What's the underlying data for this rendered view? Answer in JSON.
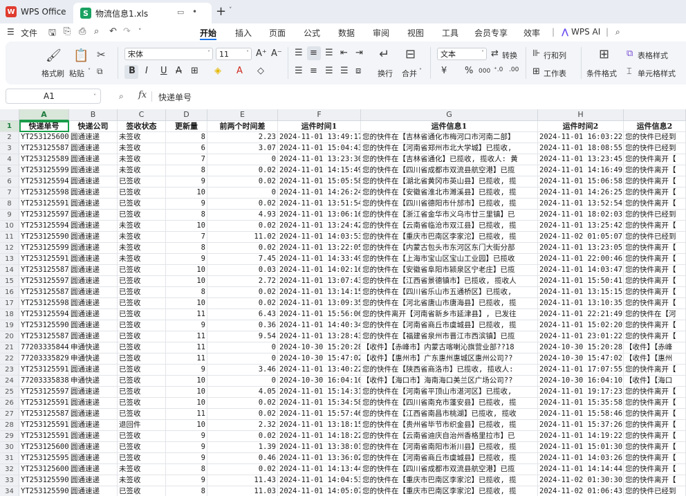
{
  "titlebar": {
    "app_tab": "WPS Office",
    "app_logo": "W",
    "file_tab": "物流信息1.xls",
    "file_logo": "S",
    "new_tab": "+",
    "tab_menu": "˅",
    "window_icon": "▭",
    "modified_dot": "•"
  },
  "menubar": {
    "file_menu": "文件",
    "tabs": [
      "开始",
      "插入",
      "页面",
      "公式",
      "数据",
      "审阅",
      "视图",
      "工具",
      "会员专享",
      "效率",
      "WPS AI"
    ],
    "active_tab": "开始"
  },
  "ribbon": {
    "format_painter": "格式刷",
    "paste": "粘贴",
    "font_name": "宋体",
    "font_size": "11",
    "grow_font": "A⁺",
    "shrink_font": "A⁻",
    "bold": "B",
    "italic": "I",
    "underline": "U",
    "strike": "A",
    "wrap": "换行",
    "merge": "合并",
    "number_format": "文本",
    "convert": "转换",
    "currency": "¥",
    "percent": "%",
    "thousands": "000",
    "rows_cols": "行和列",
    "worksheet": "工作表",
    "cond_format": "条件格式",
    "table_style": "表格样式",
    "cell_style": "单元格样式"
  },
  "formula": {
    "cell_ref": "A1",
    "fx_label": "fx",
    "value": "快递单号"
  },
  "grid": {
    "columns": [
      "A",
      "B",
      "C",
      "D",
      "E",
      "F",
      "G",
      "H"
    ],
    "headers": [
      "快递单号",
      "快递公司",
      "签收状态",
      "更新量",
      "前两个时间差",
      "运件时间1",
      "运件信息1",
      "运件时间2",
      "运件信息2"
    ],
    "rows": [
      [
        "YT253125600",
        "圆通速递",
        "未签收",
        "8",
        "2.23",
        "2024-11-01 13:49:17",
        "您的快件在【吉林省通化市梅河口市河南二部】",
        "2024-11-01 16:03:22",
        "您的快件已经到"
      ],
      [
        "YT253125587",
        "圆通速递",
        "未签收",
        "6",
        "3.07",
        "2024-11-01 15:04:43",
        "您的快件在【河南省郑州市北大学城】已揽收,",
        "2024-11-01 18:08:55",
        "您的快件已经到"
      ],
      [
        "YT253125589",
        "圆通速递",
        "未签收",
        "7",
        "0",
        "2024-11-01 13:23:30",
        "您的快件在【吉林省通化】已揽收, 揽收人: 黄",
        "2024-11-01 13:23:45",
        "您的快件离开【"
      ],
      [
        "YT253125599",
        "圆通速递",
        "未签收",
        "8",
        "0.02",
        "2024-11-01 14:15:49",
        "您的快件在【四川省成都市双流县航空港】已揽",
        "2024-11-01 14:16:49",
        "您的快件离开【"
      ],
      [
        "YT253125594",
        "圆通速递",
        "已签收",
        "9",
        "0.02",
        "2024-11-01 15:05:58",
        "您的快件在【湖北省黄冈市英山县】已揽收, 揽",
        "2024-11-01 15:06:58",
        "您的快件离开【"
      ],
      [
        "YT253125598",
        "圆通速递",
        "已签收",
        "10",
        "0",
        "2024-11-01 14:26:24",
        "您的快件在【安徽省淮北市濉溪县】已揽收, 揽",
        "2024-11-01 14:26:25",
        "您的快件离开【"
      ],
      [
        "YT253125591",
        "圆通速递",
        "已签收",
        "9",
        "0.02",
        "2024-11-01 13:51:54",
        "您的快件在【四川省德阳市什邡市】已揽收, 揽",
        "2024-11-01 13:52:54",
        "您的快件离开【"
      ],
      [
        "YT253125597",
        "圆通速递",
        "已签收",
        "8",
        "4.93",
        "2024-11-01 13:06:16",
        "您的快件在【浙江省金华市义乌市廿三里镇】已",
        "2024-11-01 18:02:03",
        "您的快件已经到"
      ],
      [
        "YT253125594",
        "圆通速递",
        "未签收",
        "10",
        "0.02",
        "2024-11-01 13:24:42",
        "您的快件在【云南省临沧市双江县】已揽收, 揽",
        "2024-11-01 13:25:42",
        "您的快件离开【"
      ],
      [
        "YT253125590",
        "圆通速递",
        "未签收",
        "7",
        "11.02",
        "2024-11-01 14:03:53",
        "您的快件在【重庆市巴南区李家沱】已揽收, 揽",
        "2024-11-02 01:05:07",
        "您的快件已经到"
      ],
      [
        "YT253125599",
        "圆通速递",
        "未签收",
        "8",
        "0.02",
        "2024-11-01 13:22:05",
        "您的快件在【内蒙古包头市东河区东门大街分部",
        "2024-11-01 13:23:05",
        "您的快件离开【"
      ],
      [
        "YT253125591",
        "圆通速递",
        "未签收",
        "9",
        "7.45",
        "2024-11-01 14:33:49",
        "您的快件在【上海市宝山区宝山工业园】已揽收",
        "2024-11-01 22:00:46",
        "您的快件离开【"
      ],
      [
        "YT253125587",
        "圆通速递",
        "已签收",
        "10",
        "0.03",
        "2024-11-01 14:02:16",
        "您的快件在【安徽省阜阳市颍泉区宁老庄】已揽",
        "2024-11-01 14:03:47",
        "您的快件离开【"
      ],
      [
        "YT253125597",
        "圆通速递",
        "已签收",
        "10",
        "2.72",
        "2024-11-01 13:07:43",
        "您的快件在【江西省景德镇市】已揽收, 揽收人",
        "2024-11-01 15:50:41",
        "您的快件离开【"
      ],
      [
        "YT253125587",
        "圆通速递",
        "已签收",
        "8",
        "0.02",
        "2024-11-01 13:14:15",
        "您的快件在【四川省乐山市五通桥区】已揽收,",
        "2024-11-01 13:15:15",
        "您的快件离开【"
      ],
      [
        "YT253125598",
        "圆通速递",
        "已签收",
        "10",
        "0.02",
        "2024-11-01 13:09:35",
        "您的快件在【河北省唐山市唐海县】已揽收, 揽",
        "2024-11-01 13:10:35",
        "您的快件离开【"
      ],
      [
        "YT253125594",
        "圆通速递",
        "已签收",
        "11",
        "6.43",
        "2024-11-01 15:56:06",
        "您的快件离开【河南省新乡市延津县】, 已发往",
        "2024-11-01 22:21:49",
        "您的快件在【河"
      ],
      [
        "YT253125590",
        "圆通速递",
        "已签收",
        "9",
        "0.36",
        "2024-11-01 14:40:34",
        "您的快件在【河南省商丘市虞城县】已揽收, 揽",
        "2024-11-01 15:02:20",
        "您的快件离开【"
      ],
      [
        "YT253125587",
        "圆通速递",
        "已签收",
        "11",
        "9.54",
        "2024-11-01 13:28:43",
        "您的快件在【福建省泉州市晋江市西滨镇】已揽",
        "2024-11-01 23:01:22",
        "您的快件离开【"
      ],
      [
        "77203335844",
        "申通快递",
        "已签收",
        "11",
        "0",
        "2024-10-30 15:20:28",
        "【收件】【赤峰市】内蒙古喀喇沁旗营业部??18",
        "2024-10-30 15:20:28",
        "【收件】【赤峰"
      ],
      [
        "77203335829",
        "申通快递",
        "已签收",
        "11",
        "0",
        "2024-10-30 15:47:02",
        "【收件】【惠州市】广东惠州惠城区惠州公司??",
        "2024-10-30 15:47:02",
        "【收件】【惠州"
      ],
      [
        "YT253125591",
        "圆通速递",
        "已签收",
        "9",
        "3.46",
        "2024-11-01 13:40:22",
        "您的快件在【陕西省商洛市】已揽收, 揽收人:",
        "2024-11-01 17:07:55",
        "您的快件离开【"
      ],
      [
        "77203335838",
        "申通快递",
        "已签收",
        "10",
        "0",
        "2024-10-30 16:04:10",
        "【收件】【海口市】海南海口美兰区广场公司??",
        "2024-10-30 16:04:10",
        "【收件】【海口"
      ],
      [
        "YT253125597",
        "圆通速递",
        "已签收",
        "10",
        "4.05",
        "2024-11-01 15:14:31",
        "您的快件在【河南省平顶山市湛河区】已揽收,",
        "2024-11-01 19:17:23",
        "您的快件离开【"
      ],
      [
        "YT253125591",
        "圆通速递",
        "已签收",
        "10",
        "0.02",
        "2024-11-01 15:34:58",
        "您的快件在【四川省南充市蓬安县】已揽收, 揽",
        "2024-11-01 15:35:58",
        "您的快件离开【"
      ],
      [
        "YT253125587",
        "圆通速递",
        "已签收",
        "11",
        "0.02",
        "2024-11-01 15:57:46",
        "您的快件在【江西省南昌市桃湖】已揽收, 揽收",
        "2024-11-01 15:58:46",
        "您的快件离开【"
      ],
      [
        "YT253125591",
        "圆通速递",
        "退回件",
        "10",
        "2.32",
        "2024-11-01 13:18:15",
        "您的快件在【贵州省毕节市织金县】已揽收, 揽",
        "2024-11-01 15:37:26",
        "您的快件离开【"
      ],
      [
        "YT253125591",
        "圆通速递",
        "已签收",
        "9",
        "0.02",
        "2024-11-01 14:18:22",
        "您的快件在【云南省迪庆自治州香格里拉市】已",
        "2024-11-01 14:19:22",
        "您的快件离开【"
      ],
      [
        "YT253125600",
        "圆通速递",
        "已签收",
        "9",
        "1.39",
        "2024-11-01 13:38:01",
        "您的快件在【河南省南阳市淅川县】已揽收, 揽",
        "2024-11-01 15:01:30",
        "您的快件离开【"
      ],
      [
        "YT253125595",
        "圆通速递",
        "已签收",
        "9",
        "0.46",
        "2024-11-01 13:36:02",
        "您的快件在【河南省商丘市虞城县】已揽收, 揽",
        "2024-11-01 14:03:26",
        "您的快件离开【"
      ],
      [
        "YT253125600",
        "圆通速递",
        "未签收",
        "8",
        "0.02",
        "2024-11-01 14:13:44",
        "您的快件在【四川省成都市双流县航空港】已揽",
        "2024-11-01 14:14:44",
        "您的快件离开【"
      ],
      [
        "YT253125590",
        "圆通速递",
        "未签收",
        "9",
        "11.43",
        "2024-11-01 14:04:53",
        "您的快件在【重庆市巴南区李家沱】已揽收, 揽",
        "2024-11-02 01:30:30",
        "您的快件离开【"
      ],
      [
        "YT253125590",
        "圆通速递",
        "已签收",
        "8",
        "11.03",
        "2024-11-01 14:05:07",
        "您的快件在【重庆市巴南区李家沱】已揽收, 揽",
        "2024-11-02 01:06:43",
        "您的快件已经到"
      ]
    ]
  }
}
